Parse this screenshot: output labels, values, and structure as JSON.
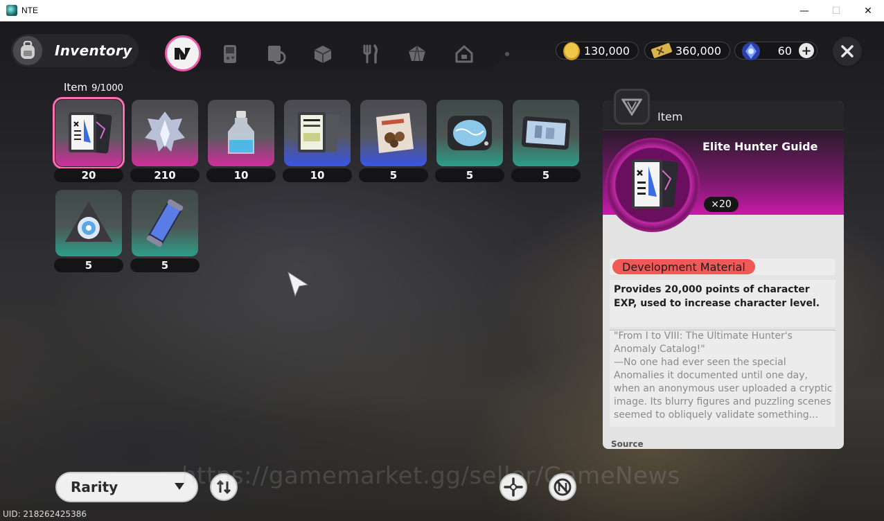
{
  "window": {
    "title": "NTE",
    "minimize": "—",
    "maximize": "☐",
    "close": "✕"
  },
  "header": {
    "title": "Inventory",
    "categories": [
      {
        "icon": "n-logo-icon",
        "active": true
      },
      {
        "icon": "handheld-console-icon",
        "active": false
      },
      {
        "icon": "notebook-icon",
        "active": false
      },
      {
        "icon": "box-icon",
        "active": false
      },
      {
        "icon": "fork-knife-icon",
        "active": false
      },
      {
        "icon": "crystal-icon",
        "active": false
      },
      {
        "icon": "house-icon",
        "active": false
      }
    ],
    "currencies": [
      {
        "icon": "gold-coin-icon",
        "value": "130,000"
      },
      {
        "icon": "ticket-icon",
        "value": "360,000"
      },
      {
        "icon": "blue-crystal-icon",
        "value": "60",
        "add_label": "+"
      }
    ]
  },
  "inventory": {
    "category_label": "Item",
    "capacity": "9/1000",
    "items": [
      {
        "name": "elite-hunter-guide",
        "qty": "20",
        "rarity": "pink",
        "selected": true
      },
      {
        "name": "crystal-trophy",
        "qty": "210",
        "rarity": "pink"
      },
      {
        "name": "potion-bottle",
        "qty": "10",
        "rarity": "pink"
      },
      {
        "name": "document-stack",
        "qty": "10",
        "rarity": "blue"
      },
      {
        "name": "snack-bag",
        "qty": "5",
        "rarity": "blue"
      },
      {
        "name": "scanner-device",
        "qty": "5",
        "rarity": "teal"
      },
      {
        "name": "tablet-device",
        "qty": "5",
        "rarity": "teal"
      },
      {
        "name": "triangle-module",
        "qty": "5",
        "rarity": "teal"
      },
      {
        "name": "energy-canister",
        "qty": "5",
        "rarity": "teal"
      }
    ]
  },
  "detail": {
    "header_label": "Item",
    "name": "Elite Hunter Guide",
    "quantity": "×20",
    "tag": "Development Material",
    "description": "Provides 20,000 points of character EXP, used to increase character level.",
    "lore_lines": [
      "\"From I to VIII: The Ultimate Hunter's",
      "Anomaly Catalog!\"",
      "—No one had ever seen the special",
      "Anomalies it documented until one day,",
      "when an anonymous user uploaded a cryptic",
      "image. Its blurry figures and puzzling scenes",
      "seemed to obliquely validate something..."
    ],
    "source_label": "Source"
  },
  "footer": {
    "sort_label": "Rarity",
    "watermark": "https://gamemarket.gg/seller/GameNews",
    "uid": "UID: 218262425386"
  },
  "colors": {
    "accent_pink": "#ee5aa8",
    "rarity_pink": "#d02d9c",
    "rarity_blue": "#3a55e6",
    "rarity_teal": "#2d9e88",
    "tag_red": "#f15858"
  }
}
